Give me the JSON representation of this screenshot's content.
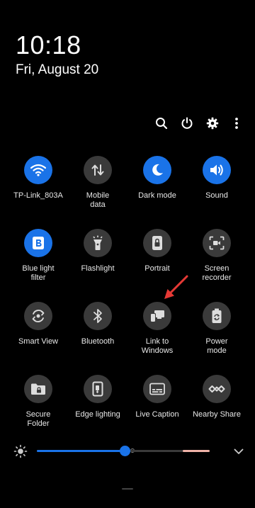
{
  "status": {
    "time": "10:18",
    "date": "Fri, August 20"
  },
  "top_actions": [
    {
      "name": "search",
      "icon": "search-icon"
    },
    {
      "name": "power",
      "icon": "power-icon"
    },
    {
      "name": "settings",
      "icon": "gear-icon"
    },
    {
      "name": "more",
      "icon": "more-vertical-icon"
    }
  ],
  "tiles": [
    {
      "label": "TP-Link_803A",
      "icon": "wifi-icon",
      "state": "on"
    },
    {
      "label": "Mobile\ndata",
      "icon": "mobile-data-icon",
      "state": "off"
    },
    {
      "label": "Dark mode",
      "icon": "moon-icon",
      "state": "on"
    },
    {
      "label": "Sound",
      "icon": "speaker-icon",
      "state": "on"
    },
    {
      "label": "Blue light\nfilter",
      "icon": "blue-light-icon",
      "state": "on"
    },
    {
      "label": "Flashlight",
      "icon": "flashlight-icon",
      "state": "off"
    },
    {
      "label": "Portrait",
      "icon": "portrait-lock-icon",
      "state": "off"
    },
    {
      "label": "Screen\nrecorder",
      "icon": "screen-recorder-icon",
      "state": "off"
    },
    {
      "label": "Smart View",
      "icon": "smart-view-icon",
      "state": "off"
    },
    {
      "label": "Bluetooth",
      "icon": "bluetooth-icon",
      "state": "off"
    },
    {
      "label": "Link to\nWindows",
      "icon": "link-to-windows-icon",
      "state": "off"
    },
    {
      "label": "Power\nmode",
      "icon": "battery-recycle-icon",
      "state": "off"
    },
    {
      "label": "Secure\nFolder",
      "icon": "secure-folder-icon",
      "state": "off"
    },
    {
      "label": "Edge lighting",
      "icon": "edge-lighting-icon",
      "state": "off"
    },
    {
      "label": "Live Caption",
      "icon": "live-caption-icon",
      "state": "off"
    },
    {
      "label": "Nearby Share",
      "icon": "nearby-share-icon",
      "state": "off"
    }
  ],
  "pager": {
    "pages": 2,
    "current": 1
  },
  "brightness": {
    "level": 0.51
  },
  "colors": {
    "accent": "#1a73e8",
    "tile_off": "#3a3a3a",
    "background": "#000000",
    "annotation_arrow": "#e53935"
  }
}
